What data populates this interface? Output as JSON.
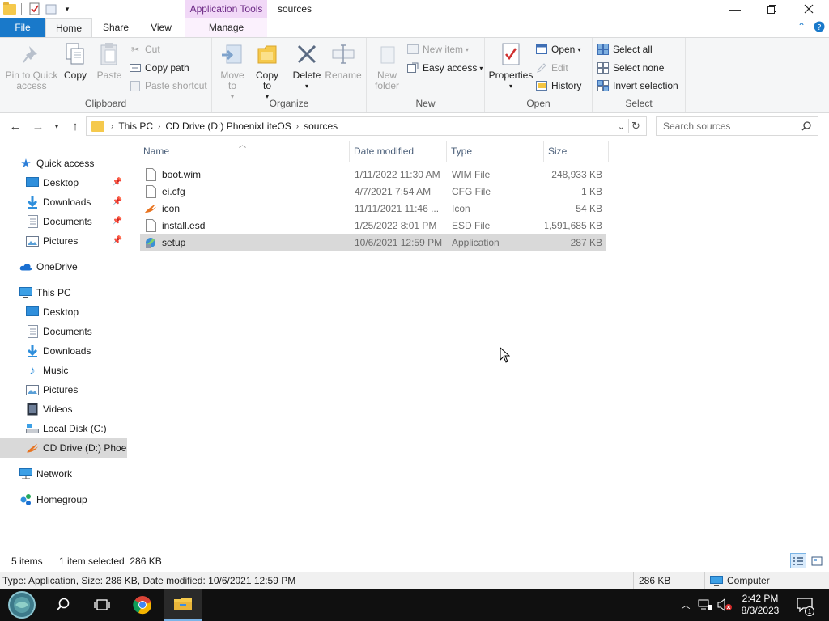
{
  "window": {
    "title": "sources",
    "contextual_tab_group": "Application Tools"
  },
  "ribbon_tabs": {
    "file": "File",
    "home": "Home",
    "share": "Share",
    "view": "View",
    "manage": "Manage"
  },
  "ribbon": {
    "clipboard": {
      "label": "Clipboard",
      "pin_to_quick_access": "Pin to Quick access",
      "copy": "Copy",
      "paste": "Paste",
      "cut": "Cut",
      "copy_path": "Copy path",
      "paste_shortcut": "Paste shortcut"
    },
    "organize": {
      "label": "Organize",
      "move_to": "Move to",
      "copy_to": "Copy to",
      "delete": "Delete",
      "rename": "Rename"
    },
    "new": {
      "label": "New",
      "new_folder": "New folder",
      "new_item": "New item",
      "easy_access": "Easy access"
    },
    "open": {
      "label": "Open",
      "properties": "Properties",
      "open": "Open",
      "edit": "Edit",
      "history": "History"
    },
    "select": {
      "label": "Select",
      "select_all": "Select all",
      "select_none": "Select none",
      "invert_selection": "Invert selection"
    }
  },
  "address": {
    "crumbs": [
      "This PC",
      "CD Drive (D:) PhoenixLiteOS",
      "sources"
    ],
    "search_placeholder": "Search sources"
  },
  "nav": {
    "quick_access": "Quick access",
    "qa_desktop": "Desktop",
    "qa_downloads": "Downloads",
    "qa_documents": "Documents",
    "qa_pictures": "Pictures",
    "onedrive": "OneDrive",
    "this_pc": "This PC",
    "pc_desktop": "Desktop",
    "pc_documents": "Documents",
    "pc_downloads": "Downloads",
    "pc_music": "Music",
    "pc_pictures": "Pictures",
    "pc_videos": "Videos",
    "local_disk": "Local Disk (C:)",
    "cd_drive": "CD Drive (D:) Phoer",
    "network": "Network",
    "homegroup": "Homegroup"
  },
  "columns": {
    "name": "Name",
    "date_modified": "Date modified",
    "type": "Type",
    "size": "Size"
  },
  "files": [
    {
      "name": "boot.wim",
      "date": "1/11/2022 11:30 AM",
      "type": "WIM File",
      "size": "248,933 KB"
    },
    {
      "name": "ei.cfg",
      "date": "4/7/2021 7:54 AM",
      "type": "CFG File",
      "size": "1 KB"
    },
    {
      "name": "icon",
      "date": "11/11/2021 11:46 ...",
      "type": "Icon",
      "size": "54 KB"
    },
    {
      "name": "install.esd",
      "date": "1/25/2022 8:01 PM",
      "type": "ESD File",
      "size": "1,591,685 KB"
    },
    {
      "name": "setup",
      "date": "10/6/2021 12:59 PM",
      "type": "Application",
      "size": "287 KB"
    }
  ],
  "status": {
    "item_count": "5 items",
    "selection": "1 item selected  286 KB"
  },
  "details": {
    "text": "Type: Application, Size: 286 KB, Date modified: 10/6/2021 12:59 PM",
    "size": "286 KB",
    "location": "Computer"
  },
  "taskbar": {
    "time": "2:42 PM",
    "date": "8/3/2023",
    "notification_count": "1"
  }
}
